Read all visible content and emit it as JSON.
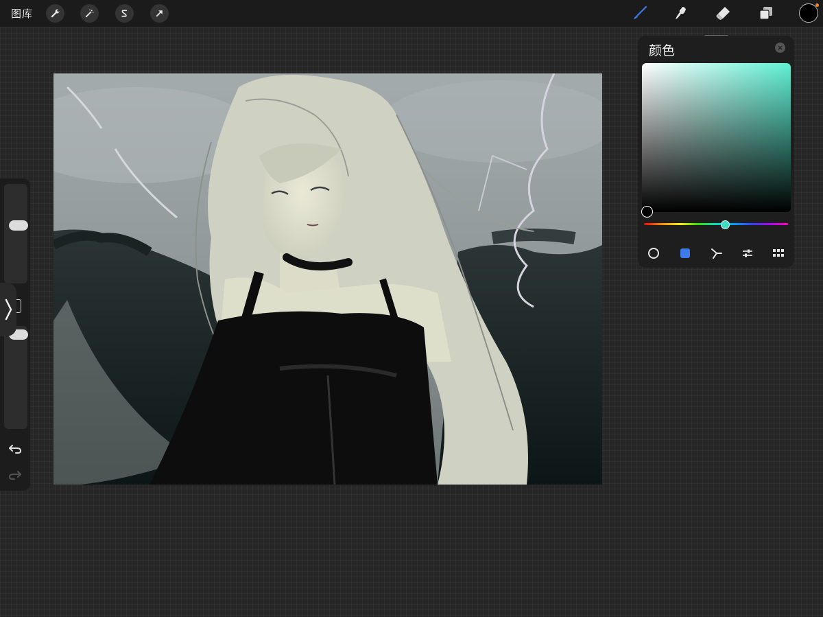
{
  "toolbar": {
    "gallery_label": "图库",
    "left_tools": [
      {
        "name": "wrench-icon",
        "action": "actions"
      },
      {
        "name": "magic-wand-icon",
        "action": "adjustments"
      },
      {
        "name": "selection-s-icon",
        "action": "selection"
      },
      {
        "name": "arrow-cursor-icon",
        "action": "transform"
      }
    ],
    "right_tools": [
      {
        "name": "brush-icon",
        "active": true
      },
      {
        "name": "smudge-icon",
        "active": false
      },
      {
        "name": "eraser-icon",
        "active": false
      },
      {
        "name": "layers-icon",
        "active": false
      }
    ],
    "current_color": "#000000",
    "active_tool_color": "#3d7bea"
  },
  "color_panel": {
    "title": "颜色",
    "hue_color": "#5ff0d4",
    "hue_position": 0.53,
    "selected_color": "#000000",
    "modes": [
      "disc-mode-icon",
      "classic-mode-icon",
      "harmony-mode-icon",
      "value-mode-icon",
      "palettes-mode-icon"
    ],
    "active_mode": "classic-mode-icon",
    "active_mode_color": "#3d7bea"
  },
  "sidebar": {
    "brush_size_level": 0.25,
    "opacity_level": 0.15,
    "icons": [
      "modify-button",
      "undo-icon",
      "redo-icon"
    ]
  }
}
